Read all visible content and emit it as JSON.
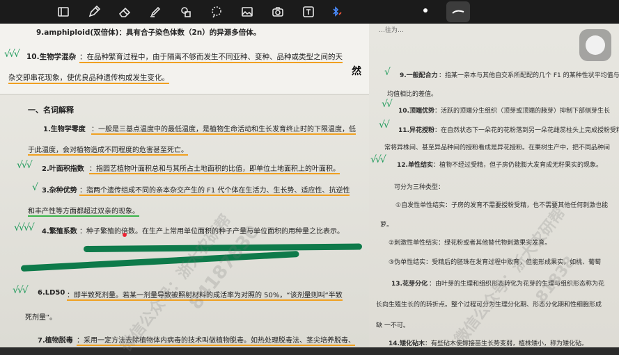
{
  "toolbar": {
    "icons": [
      "page-icon",
      "pen-icon",
      "eraser-icon",
      "highlighter-icon",
      "shapes-icon",
      "lasso-icon",
      "image-icon",
      "camera-icon",
      "text-icon",
      "bluetooth-pen-icon"
    ]
  },
  "left": {
    "line1": "9.amphiploid(双倍体)：具有合子染色体数（2n）的异源多倍体。",
    "line2a": "10.生物学混杂",
    "line2b": "：在品种繁育过程中，由于隔离不够而发生不同亚种、变种、品种或类型之间的天",
    "line3": "杂交即串花现象，使优良品种遗传构成发生变化。",
    "glyph": "然",
    "section": "一、名词解释",
    "d1_label": "1.生物学零度",
    "d1a": "：一般是三基点温度中的最低温度，是植物生命活动和生长发育终止时的下限温度，低",
    "d1b": "于此温度，会对植物造成不同程度的危害甚至死亡。",
    "d2_label": "2.叶面积指数",
    "d2a": "：指园艺植物叶面积总和与其所占土地面积的比值，即单位土地面积上的叶面积。",
    "d3_label": "3.杂种优势",
    "d3a": "：指两个遗传组成不同的亲本杂交产生的 F1 代个体在生活力、生长势、适应性、抗逆性",
    "d3b": "和丰产性等方面都超过双亲的现象。",
    "d4_label": "4.繁殖系数",
    "d4a": "：种子繁殖的倍数。在生产上常用单位面积的种子产量与单位面积的用种量之比表示。",
    "d6_label": "6.LD50",
    "d6a": "：即半致死剂量。若某一剂量导致被照射材料的成活率为对照的 50%，“该剂量则叫“半致",
    "d6b": "死剂量”。",
    "d7_label": "7.植物脱毒",
    "d7a": "：采用一定方法去除植物体内病毒的技术叫做植物脱毒。如热处理脱毒法、茎尖培养脱毒、",
    "checks": [
      "√√√",
      "√√√",
      "√",
      "√√√√",
      "√√√"
    ]
  },
  "right": {
    "top": "…往为…",
    "r9_label": "9.一般配合力",
    "r9a": "：指某一亲本与其他自交系所配配的几个 F1 的某种性状平均值与",
    "r9b": "均值相比的差值。",
    "r10_label": "10.顶端优势",
    "r10a": "：活跃的顶端分生组织（顶芽或顶端的腋芽）抑制下部侧芽生长",
    "r11_label": "11.异花授粉",
    "r11a": "：在自然状态下一朵花的花粉落到另一朵花雌蕊柱头上完成授粉受精",
    "r11b": "常将异株间、甚至异品种间的授粉看成是异花授粉。在果树生产中，把不同品种间",
    "r12_label": "12.单性结实",
    "r12a": "：植物不经过受精，但子房仍能膨大发育成无籽果实的现象。",
    "r12b": "可分为三种类型：",
    "r12c": "①自发性单性结实：子房的发育不需要授粉受精，也不需要其他任何刺激也能",
    "r12d": "萝。",
    "r12e": "②刺激性单性结实：绿花粉或者其他替代物刺激果实发育。",
    "r12f": "③伪单性结实：受精后的胚珠在发育过程中败育，但能形成果实，如桃、葡萄",
    "r13_label": "13.花芽分化",
    "r13a": "：由叶芽的生理和组织形态转化为花芽的生理与组织形态称为花",
    "r13b": "长向生殖生长的的转折点。整个过程可分为生理分化期、形态分化期和性细胞形成",
    "r13c": "缺 一不可。",
    "r14_label": "14.矮化砧木",
    "r14a": "：有些砧木使嫁接苗生长势变弱，植株矮小，称为矮化砧。",
    "checks": [
      "√",
      "√√",
      "√√",
      "√√√"
    ]
  },
  "watermark": [
    "微信公众号：浙大农研帮",
    "84187830",
    "微信公众号：浙大农研帮",
    "81838"
  ]
}
